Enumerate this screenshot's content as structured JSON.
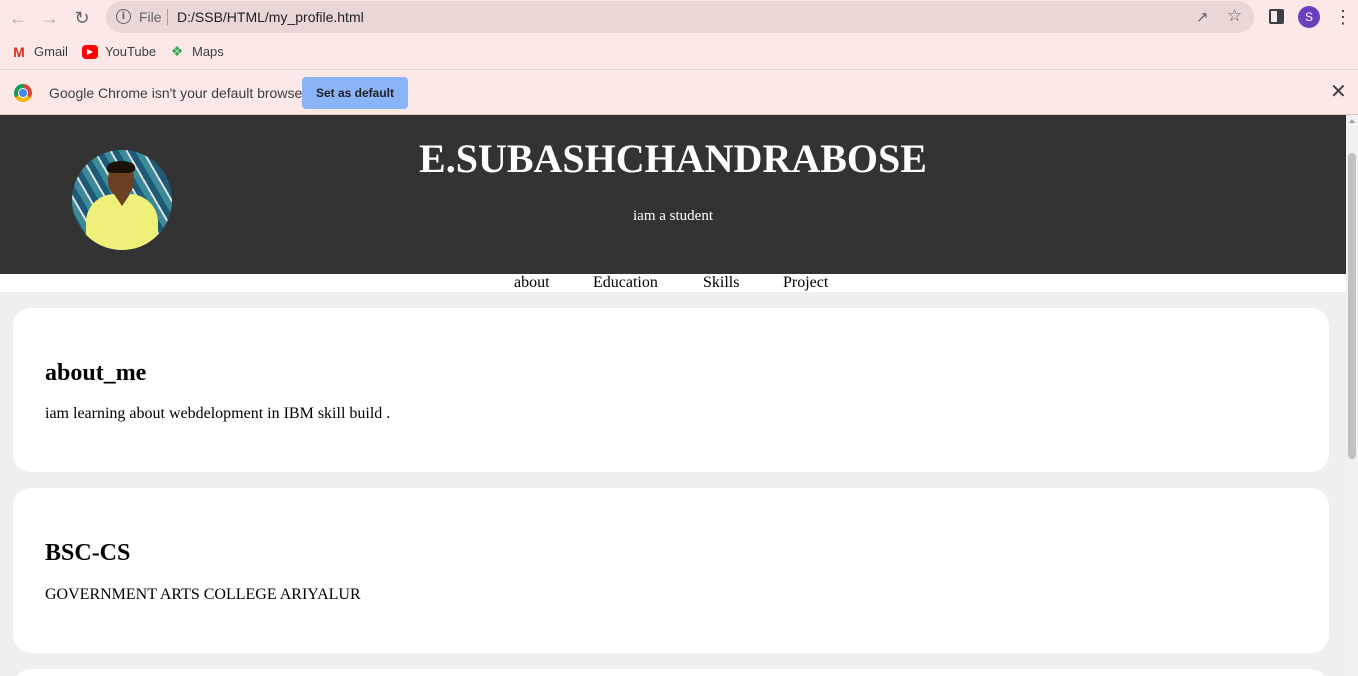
{
  "browser": {
    "address_scheme": "File",
    "url": "D:/SSB/HTML/my_profile.html",
    "profile_initial": "S",
    "bookmarks": [
      {
        "label": "Gmail",
        "icon": "gmail-icon"
      },
      {
        "label": "YouTube",
        "icon": "youtube-icon"
      },
      {
        "label": "Maps",
        "icon": "maps-icon"
      }
    ],
    "infobar": {
      "message": "Google Chrome isn't your default browser",
      "button_label": "Set as default"
    }
  },
  "page": {
    "header": {
      "name": "E.SUBASHCHANDRABOSE",
      "tagline": "iam a student"
    },
    "nav": [
      "about",
      "Education",
      "Skills",
      "Project"
    ],
    "sections": [
      {
        "heading": "about_me",
        "text": "iam learning about webdelopment in IBM skill build ."
      },
      {
        "heading": "BSC-CS",
        "text": "GOVERNMENT ARTS COLLEGE ARIYALUR"
      }
    ]
  },
  "colors": {
    "header_bg": "#333333",
    "page_bg": "#efefef",
    "card_bg": "#ffffff",
    "chrome_bg": "#fce8e6",
    "button_blue": "#8ab4f8"
  }
}
